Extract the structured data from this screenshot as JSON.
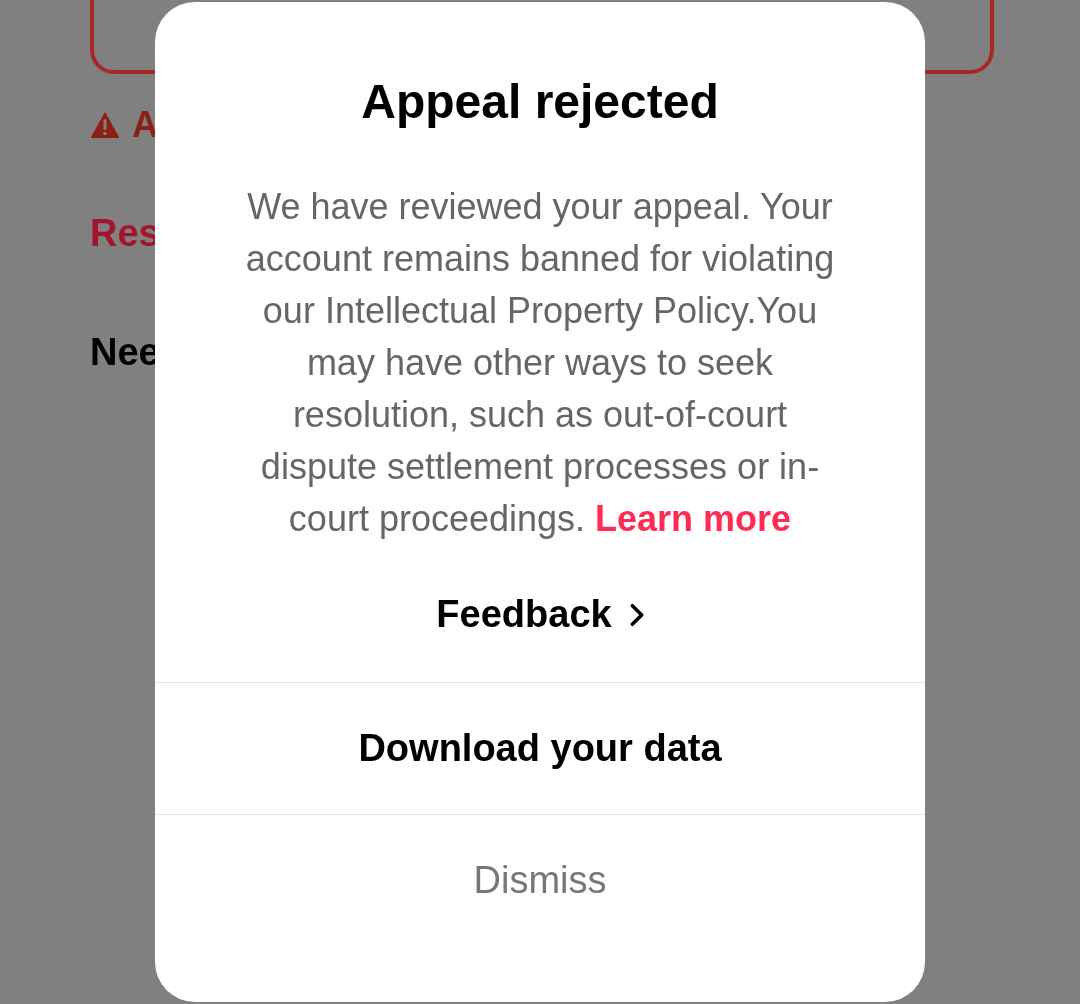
{
  "background": {
    "warning": "A",
    "link": "Res",
    "heading": "Nee"
  },
  "dialog": {
    "title": "Appeal rejected",
    "message": "We have reviewed your appeal. Your account remains banned for violating our Intellectual Property Policy.You may have other ways to seek resolution, such as out-of-court dispute settlement processes or in-court proceedings.",
    "link": "Learn more",
    "feedback": "Feedback",
    "actions": [
      {
        "label": "Download your data",
        "kind": "primary"
      },
      {
        "label": "Dismiss",
        "kind": "secondary"
      }
    ]
  }
}
